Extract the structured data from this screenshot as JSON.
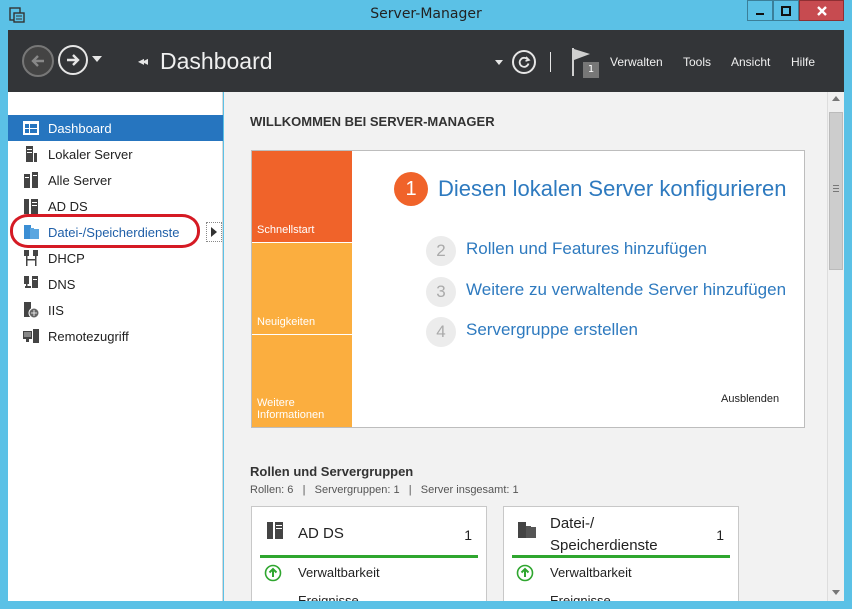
{
  "window": {
    "title": "Server-Manager"
  },
  "header": {
    "title": "Dashboard",
    "breadcrumb_arrows": "◂◂",
    "notification_count": "1",
    "menu": {
      "manage": "Verwalten",
      "tools": "Tools",
      "view": "Ansicht",
      "help": "Hilfe"
    }
  },
  "sidebar": {
    "items": [
      {
        "label": "Dashboard",
        "icon": "dashboard-icon"
      },
      {
        "label": "Lokaler Server",
        "icon": "server-icon"
      },
      {
        "label": "Alle Server",
        "icon": "servers-icon"
      },
      {
        "label": "AD DS",
        "icon": "ad-ds-icon"
      },
      {
        "label": "Datei-/Speicherdienste",
        "icon": "file-storage-icon"
      },
      {
        "label": "DHCP",
        "icon": "dhcp-icon"
      },
      {
        "label": "DNS",
        "icon": "dns-icon"
      },
      {
        "label": "IIS",
        "icon": "iis-icon"
      },
      {
        "label": "Remotezugriff",
        "icon": "remote-access-icon"
      }
    ]
  },
  "main": {
    "welcome_title": "WILLKOMMEN BEI SERVER-MANAGER",
    "tiles": {
      "quick_start": "Schnellstart",
      "news": "Neuigkeiten",
      "more_line1": "Weitere",
      "more_line2": "Informationen"
    },
    "steps": [
      {
        "num": "1",
        "label": "Diesen lokalen Server konfigurieren"
      },
      {
        "num": "2",
        "label": "Rollen und Features hinzufügen"
      },
      {
        "num": "3",
        "label": "Weitere zu verwaltende Server hinzufügen"
      },
      {
        "num": "4",
        "label": "Servergruppe erstellen"
      }
    ],
    "hide_label": "Ausblenden",
    "roles_title": "Rollen und Servergruppen",
    "roles_stats": "Rollen: 6   |   Servergruppen: 1   |   Server insgesamt: 1",
    "cards": [
      {
        "name": "AD DS",
        "count": "1",
        "row1": "Verwaltbarkeit",
        "row2": "Ereignisse"
      },
      {
        "name_line1": "Datei-/",
        "name_line2": "Speicherdienste",
        "count": "1",
        "row1": "Verwaltbarkeit",
        "row2": "Ereignisse"
      }
    ]
  },
  "colors": {
    "accent": "#2675bf",
    "orange": "#f0632a",
    "amber": "#fbae3f",
    "ok_green": "#2fa62f",
    "highlight_red": "#d51a24",
    "titlebar": "#5bc1e6"
  }
}
